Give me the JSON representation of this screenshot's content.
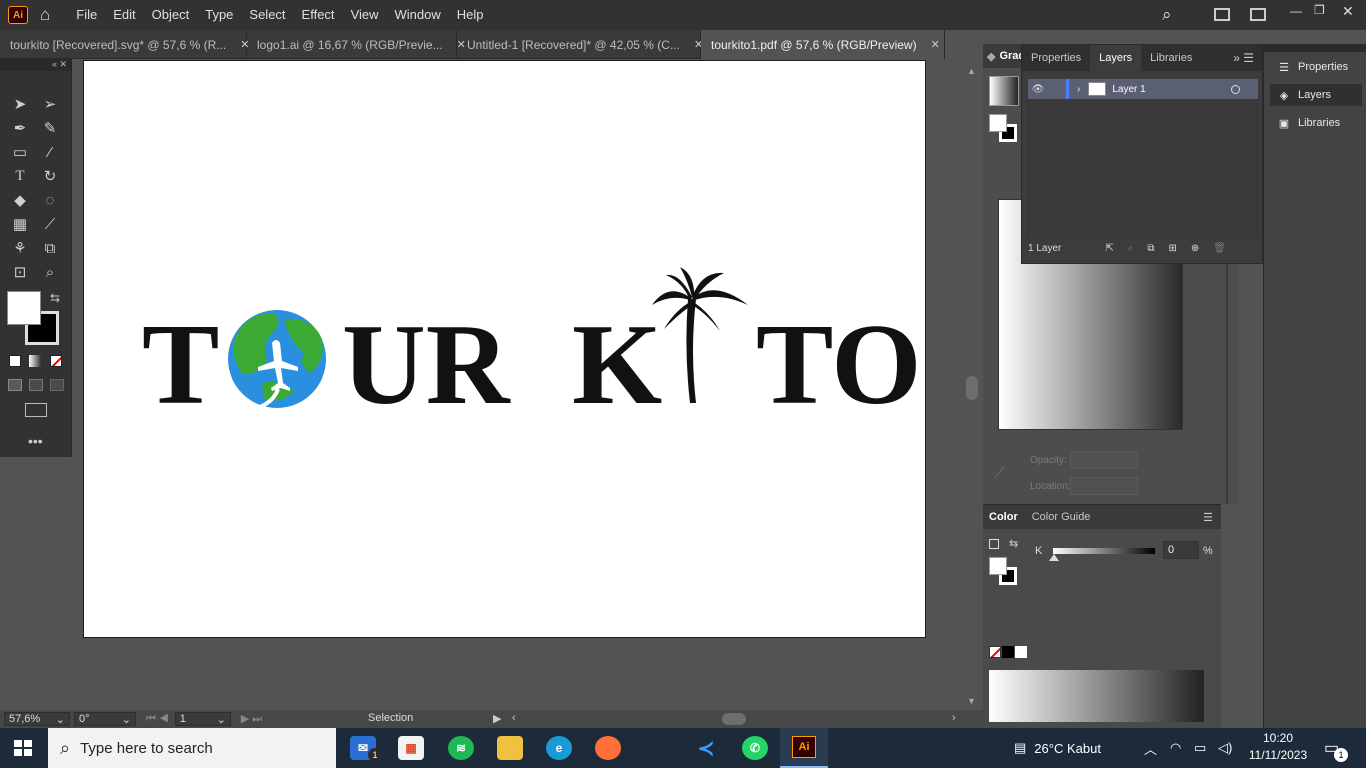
{
  "app": {
    "logo": "Ai"
  },
  "menu": [
    "File",
    "Edit",
    "Object",
    "Type",
    "Select",
    "Effect",
    "View",
    "Window",
    "Help"
  ],
  "tabs": [
    {
      "label": "tourkito [Recovered].svg* @ 57,6 % (R...",
      "active": false
    },
    {
      "label": "logo1.ai @ 16,67 % (RGB/Previe...",
      "active": false
    },
    {
      "label": "Untitled-1 [Recovered]* @ 42,05 % (C...",
      "active": false
    },
    {
      "label": "tourkito1.pdf @ 57,6 % (RGB/Preview)",
      "active": true
    }
  ],
  "artwork": {
    "left_text": "T",
    "left_text2": "UR",
    "right_text1": "K",
    "right_text2": "TO"
  },
  "status": {
    "zoom": "57,6%",
    "rotation": "0°",
    "artboard": "1",
    "mode": "Selection"
  },
  "gradient_panel": {
    "tab": "Grad",
    "opacity_label": "Opacity:",
    "location_label": "Location:"
  },
  "layers_panel": {
    "tabs": [
      "Properties",
      "Layers",
      "Libraries"
    ],
    "active_tab": "Layers",
    "layer_name": "Layer 1",
    "count": "1 Layer"
  },
  "color_panel": {
    "tabs": [
      "Color",
      "Color Guide"
    ],
    "channel": "K",
    "value": "0",
    "unit": "%"
  },
  "right_dock": [
    "Properties",
    "Layers",
    "Libraries"
  ],
  "taskbar": {
    "search_placeholder": "Type here to search",
    "weather": "26°C  Kabut",
    "time": "10:20",
    "date": "11/11/2023",
    "mail_badge": "1",
    "notif_badge": "1"
  },
  "colors": {
    "accent": "#ff9a00",
    "globe_blue": "#2b8fe0",
    "globe_green": "#3aaa35"
  }
}
